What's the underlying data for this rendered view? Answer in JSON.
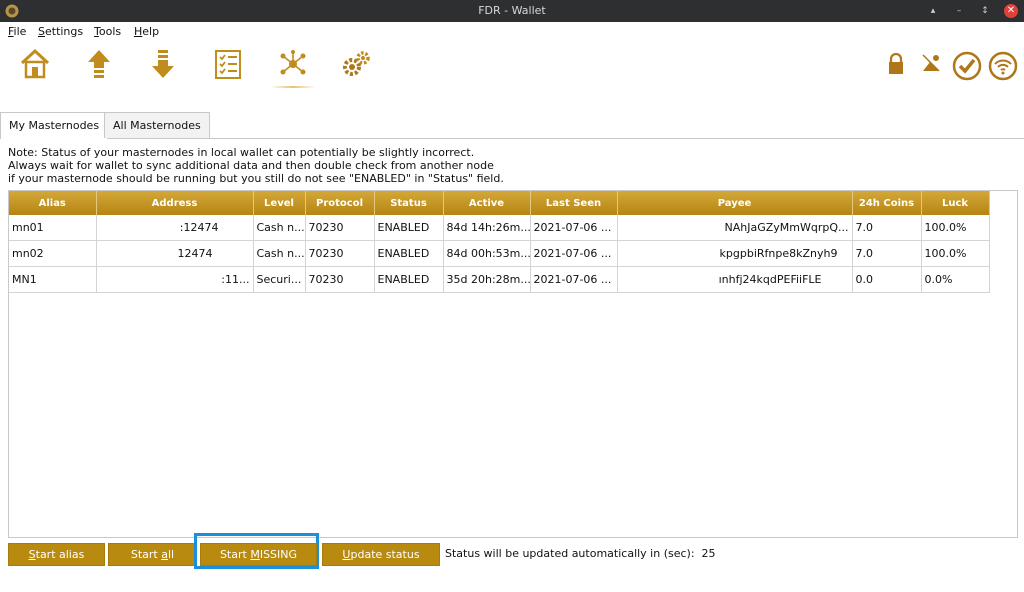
{
  "window": {
    "title": "FDR - Wallet",
    "controls": [
      "▴",
      "–",
      "↕",
      "✕"
    ]
  },
  "menu": [
    {
      "pre": "",
      "ul": "F",
      "post": "ile"
    },
    {
      "pre": "",
      "ul": "S",
      "post": "ettings"
    },
    {
      "pre": "",
      "ul": "T",
      "post": "ools"
    },
    {
      "pre": "",
      "ul": "H",
      "post": "elp"
    }
  ],
  "toolbar": {
    "buttons": [
      {
        "name": "overview-button",
        "icon": "home-icon"
      },
      {
        "name": "send-button",
        "icon": "upload-arrow-icon"
      },
      {
        "name": "receive-button",
        "icon": "download-arrow-icon"
      },
      {
        "name": "transactions-button",
        "icon": "checklist-icon"
      },
      {
        "name": "masternodes-button",
        "icon": "network-nodes-icon",
        "active": true
      },
      {
        "name": "tools-button",
        "icon": "gears-icon"
      }
    ],
    "status_icons": [
      "lock-icon",
      "staking-off-icon",
      "synced-check-icon",
      "connection-wifi-icon"
    ]
  },
  "tabs": [
    {
      "label": "My Masternodes",
      "active": true
    },
    {
      "label": "All Masternodes",
      "active": false
    }
  ],
  "note": [
    "Note: Status of your masternodes in local wallet can potentially be slightly incorrect.",
    "Always wait for wallet to sync additional data and then double check from another node",
    "if your masternode should be running but you still do not see \"ENABLED\" in \"Status\" field."
  ],
  "table": {
    "columns": [
      "Alias",
      "Address",
      "Level",
      "Protocol",
      "Status",
      "Active",
      "Last Seen",
      "Payee",
      "24h Coins",
      "Luck"
    ],
    "rows": [
      [
        "mn01",
        ":12474",
        "Cash n...",
        "70230",
        "ENABLED",
        "84d 14h:26m...",
        "2021-07-06 ...",
        "NAhJaGZyMmWqrpQ...",
        "7.0",
        "100.0%"
      ],
      [
        "mn02",
        "12474",
        "Cash n...",
        "70230",
        "ENABLED",
        "84d 00h:53m...",
        "2021-07-06 ...",
        "kpgpbiRfnpe8kZnyh9",
        "7.0",
        "100.0%"
      ],
      [
        "MN1",
        ":11...",
        "Securi...",
        "70230",
        "ENABLED",
        "35d 20h:28m...",
        "2021-07-06 ...",
        "ınhfj24kqdPEFiiFLE",
        "0.0",
        "0.0%"
      ]
    ]
  },
  "buttons": {
    "start_alias": {
      "pre": "",
      "ul": "S",
      "post": "tart alias"
    },
    "start_all": {
      "pre": "Start ",
      "ul": "a",
      "post": "ll"
    },
    "start_missing": {
      "pre": "Start ",
      "ul": "M",
      "post": "ISSING"
    },
    "update_status": {
      "pre": "",
      "ul": "U",
      "post": "pdate status"
    }
  },
  "status": {
    "label": "Status will be updated automatically in (sec):",
    "seconds": "25"
  },
  "colors": {
    "accent": "#b88a10",
    "header_gold": "#c9982a",
    "focus": "#1a8fdc",
    "titlebar": "#2e2f30"
  }
}
